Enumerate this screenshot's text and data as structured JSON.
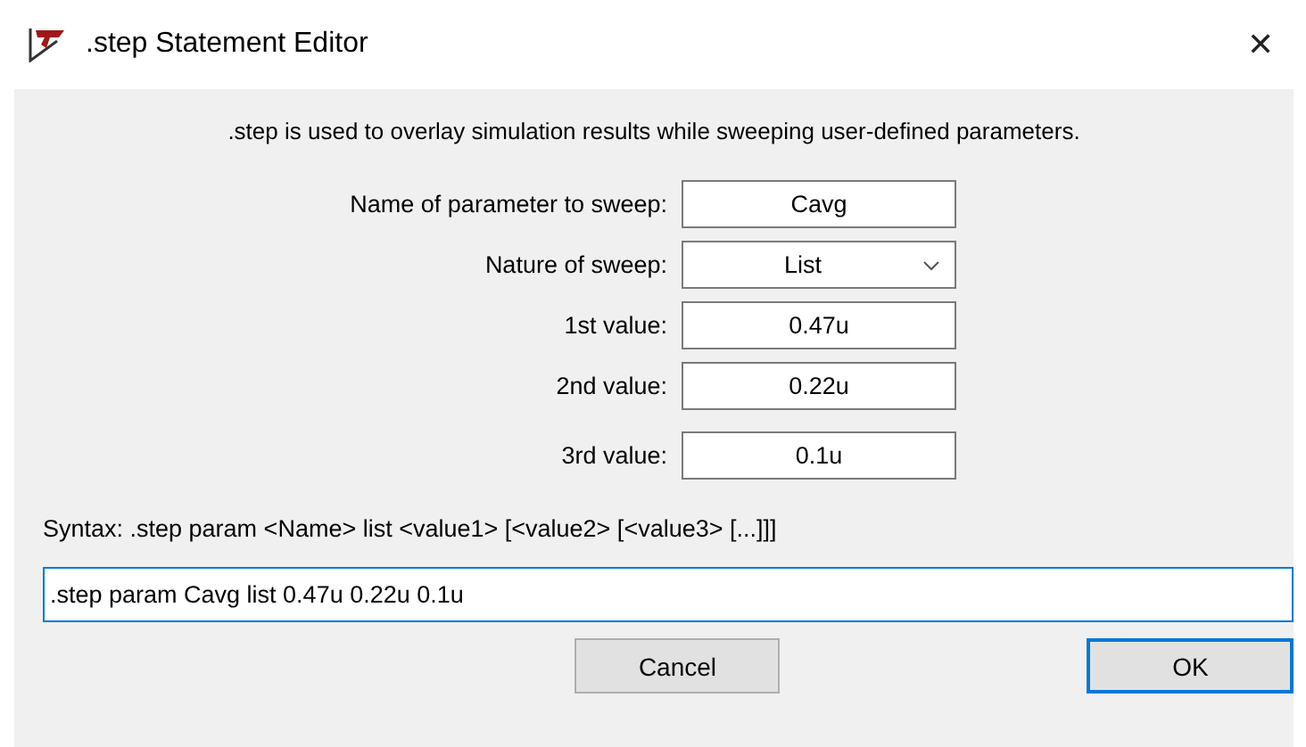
{
  "window": {
    "title": ".step Statement Editor",
    "close": "✕"
  },
  "description": ".step is used to overlay simulation results while sweeping user-defined parameters.",
  "fields": [
    {
      "kind": "text",
      "label": "Name of parameter to sweep:",
      "value": "Cavg"
    },
    {
      "kind": "dropdown",
      "label": "Nature of sweep:",
      "value": "List"
    },
    {
      "kind": "text",
      "label": "1st value:",
      "value": "0.47u"
    },
    {
      "kind": "text",
      "label": "2nd value:",
      "value": "0.22u"
    },
    {
      "kind": "text",
      "label": "3rd value:",
      "value": "0.1u"
    }
  ],
  "syntax": "Syntax:  .step param <Name> list <value1> [<value2> [<value3> [...]]]",
  "command": {
    "value": ".step param Cavg list 0.47u 0.22u 0.1u",
    "focused": true
  },
  "buttons": [
    {
      "label": "Cancel",
      "default": false
    },
    {
      "label": "OK",
      "default": true
    }
  ]
}
